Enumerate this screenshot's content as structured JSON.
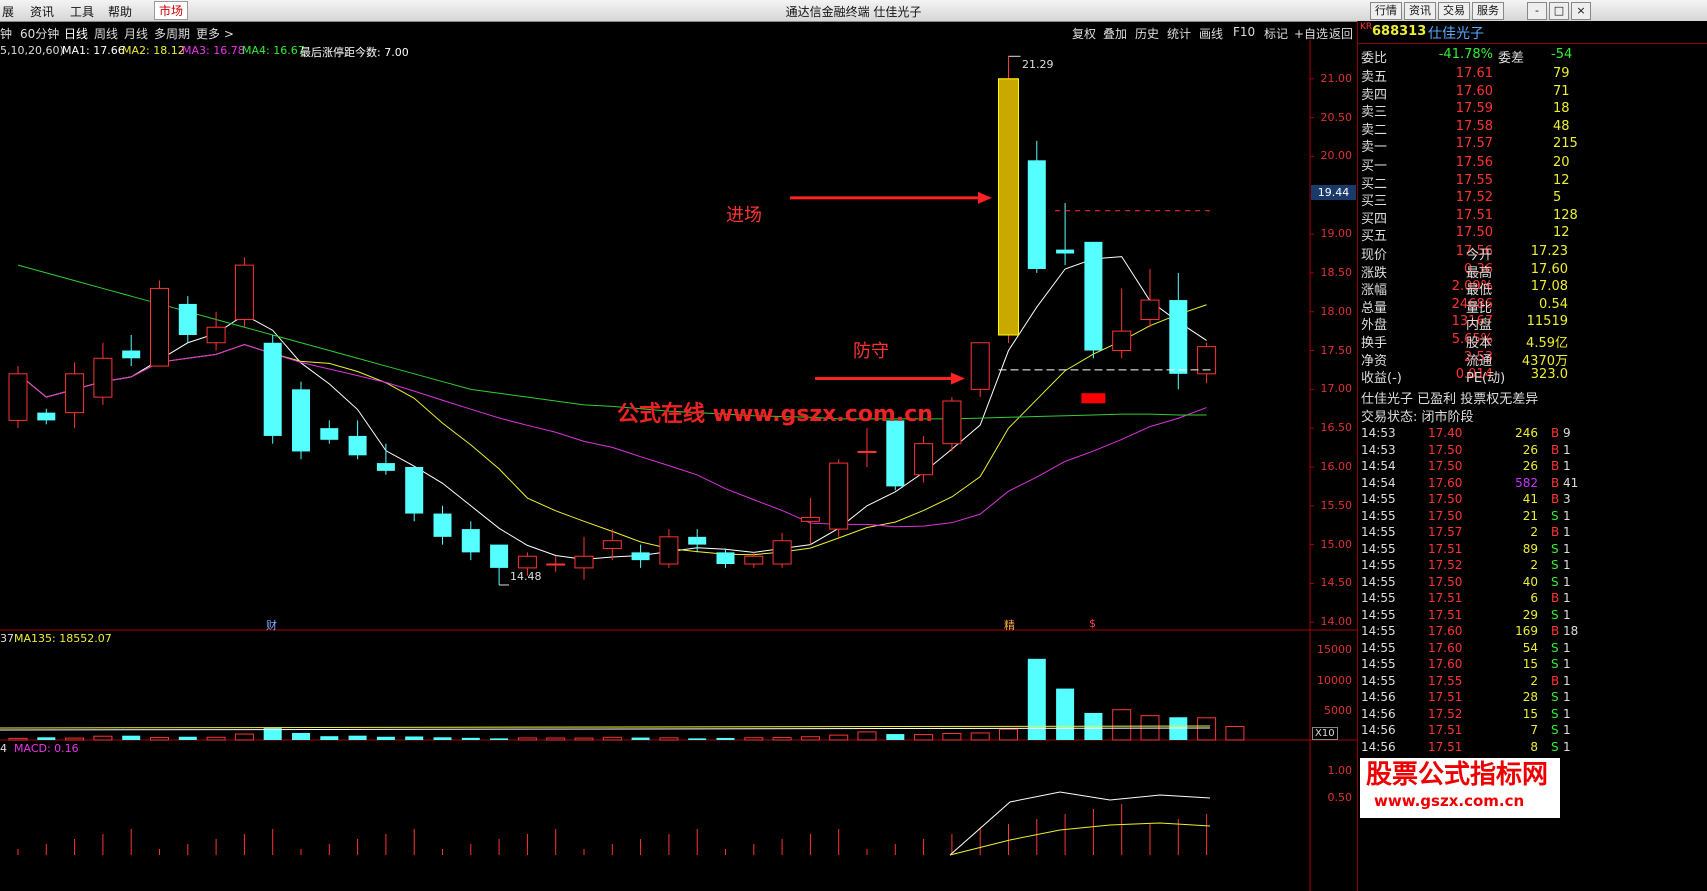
{
  "menubar": {
    "items": [
      "展",
      "资讯",
      "工具",
      "帮助",
      "市场"
    ],
    "title": "通达信金融终端  仕佳光子",
    "right_buttons": [
      "行情",
      "资讯",
      "交易",
      "服务"
    ],
    "window_buttons": [
      "-",
      "□",
      "×"
    ]
  },
  "periods": [
    "钟",
    "60分钟",
    "日线",
    "周线",
    "月线",
    "多周期",
    "更多 >"
  ],
  "tools": [
    "复权",
    "叠加",
    "历史",
    "统计",
    "画线",
    "F10",
    "标记",
    "+自选",
    "返回"
  ],
  "ma_legend": {
    "params": "5,10,20,60)",
    "ma1": "MA1: 17.66",
    "ma2": "MA2: 18.12",
    "ma3": "MA3: 16.78",
    "ma4": "MA4: 16.67",
    "extra": "最后涨停距今数: 7.00"
  },
  "price_axis": [
    "21.00",
    "20.50",
    "20.00",
    "19.50",
    "19.00",
    "18.50",
    "18.00",
    "17.50",
    "17.00",
    "16.50",
    "16.00",
    "15.50",
    "15.00",
    "14.50",
    "14.00"
  ],
  "current_price_tag": "19.44",
  "high_label": "21.29",
  "low_label": "14.48",
  "event_marks": [
    "财",
    "精",
    "$"
  ],
  "annotations": {
    "entry": "进场",
    "defend": "防守",
    "watermark": "公式在线  www.gszx.com.cn"
  },
  "volume_legend": {
    "left": "37",
    "ma135": "MA135: 18552.07"
  },
  "volume_axis": [
    "15000",
    "10000",
    "5000"
  ],
  "volume_unit": "X10",
  "macd_legend": {
    "left": "4",
    "macd": "MACD: 0.16"
  },
  "macd_axis": [
    "1.00",
    "0.50"
  ],
  "footer_logo": {
    "line1": "股票公式指标网",
    "line2": "www.gszx.com.cn"
  },
  "stock": {
    "tag": "KR",
    "code": "688313",
    "name": "仕佳光子"
  },
  "order_ratio": {
    "l1": "委比",
    "v1": "-41.78%",
    "l2": "委差",
    "v2": "-54"
  },
  "asks": [
    {
      "label": "卖五",
      "price": "17.61",
      "vol": "79"
    },
    {
      "label": "卖四",
      "price": "17.60",
      "vol": "71"
    },
    {
      "label": "卖三",
      "price": "17.59",
      "vol": "18"
    },
    {
      "label": "卖二",
      "price": "17.58",
      "vol": "48"
    },
    {
      "label": "卖一",
      "price": "17.57",
      "vol": "215"
    }
  ],
  "bids": [
    {
      "label": "买一",
      "price": "17.56",
      "vol": "20"
    },
    {
      "label": "买二",
      "price": "17.55",
      "vol": "12"
    },
    {
      "label": "买三",
      "price": "17.52",
      "vol": "5"
    },
    {
      "label": "买四",
      "price": "17.51",
      "vol": "128"
    },
    {
      "label": "买五",
      "price": "17.50",
      "vol": "12"
    }
  ],
  "quote": [
    {
      "l1": "现价",
      "v1": "17.56",
      "l2": "今开",
      "v2": "17.23"
    },
    {
      "l1": "涨跌",
      "v1": "0.36",
      "l2": "最高",
      "v2": "17.60"
    },
    {
      "l1": "涨幅",
      "v1": "2.09%",
      "l2": "最低",
      "v2": "17.08"
    },
    {
      "l1": "总量",
      "v1": "24686",
      "l2": "量比",
      "v2": "0.54"
    },
    {
      "l1": "外盘",
      "v1": "13167",
      "l2": "内盘",
      "v2": "11519"
    },
    {
      "l1": "换手",
      "v1": "5.65%",
      "l2": "股本",
      "v2": "4.59亿"
    },
    {
      "l1": "净资",
      "v1": "2.53",
      "l2": "流通",
      "v2": "4370万"
    },
    {
      "l1": "收益(-)",
      "v1": "0.014",
      "l2": "PE(动)",
      "v2": "323.0"
    }
  ],
  "status_line1": "仕佳光子 已盈利 投票权无差异",
  "status_line2": "交易状态: 闭市阶段",
  "ticks": [
    {
      "t": "14:53",
      "p": "17.40",
      "v": "246",
      "d": "B",
      "x": "9"
    },
    {
      "t": "14:53",
      "p": "17.50",
      "v": "26",
      "d": "B",
      "x": "1"
    },
    {
      "t": "14:54",
      "p": "17.50",
      "v": "26",
      "d": "B",
      "x": "1"
    },
    {
      "t": "14:54",
      "p": "17.60",
      "v": "582",
      "d": "B",
      "x": "41"
    },
    {
      "t": "14:55",
      "p": "17.50",
      "v": "41",
      "d": "B",
      "x": "3"
    },
    {
      "t": "14:55",
      "p": "17.50",
      "v": "21",
      "d": "S",
      "x": "1"
    },
    {
      "t": "14:55",
      "p": "17.57",
      "v": "2",
      "d": "B",
      "x": "1"
    },
    {
      "t": "14:55",
      "p": "17.51",
      "v": "89",
      "d": "S",
      "x": "1"
    },
    {
      "t": "14:55",
      "p": "17.52",
      "v": "2",
      "d": "S",
      "x": "1"
    },
    {
      "t": "14:55",
      "p": "17.50",
      "v": "40",
      "d": "S",
      "x": "1"
    },
    {
      "t": "14:55",
      "p": "17.51",
      "v": "6",
      "d": "B",
      "x": "1"
    },
    {
      "t": "14:55",
      "p": "17.51",
      "v": "29",
      "d": "S",
      "x": "1"
    },
    {
      "t": "14:55",
      "p": "17.60",
      "v": "169",
      "d": "B",
      "x": "18"
    },
    {
      "t": "14:55",
      "p": "17.60",
      "v": "54",
      "d": "S",
      "x": "1"
    },
    {
      "t": "14:55",
      "p": "17.60",
      "v": "15",
      "d": "S",
      "x": "1"
    },
    {
      "t": "14:55",
      "p": "17.55",
      "v": "2",
      "d": "B",
      "x": "1"
    },
    {
      "t": "14:56",
      "p": "17.51",
      "v": "28",
      "d": "S",
      "x": "1"
    },
    {
      "t": "14:56",
      "p": "17.52",
      "v": "15",
      "d": "S",
      "x": "1"
    },
    {
      "t": "14:56",
      "p": "17.51",
      "v": "7",
      "d": "S",
      "x": "1"
    },
    {
      "t": "14:56",
      "p": "17.51",
      "v": "8",
      "d": "S",
      "x": "1"
    }
  ],
  "chart_data": {
    "type": "candlestick",
    "ylim": [
      13.9,
      21.5
    ],
    "candles": [
      {
        "o": 16.6,
        "c": 17.2,
        "h": 17.3,
        "l": 16.5
      },
      {
        "o": 16.7,
        "c": 16.6,
        "h": 16.75,
        "l": 16.55
      },
      {
        "o": 16.7,
        "c": 17.2,
        "h": 17.35,
        "l": 16.5
      },
      {
        "o": 16.9,
        "c": 17.4,
        "h": 17.6,
        "l": 16.8
      },
      {
        "o": 17.5,
        "c": 17.4,
        "h": 17.7,
        "l": 17.3
      },
      {
        "o": 17.3,
        "c": 18.3,
        "h": 18.4,
        "l": 17.3
      },
      {
        "o": 18.1,
        "c": 17.7,
        "h": 18.2,
        "l": 17.6
      },
      {
        "o": 17.6,
        "c": 17.8,
        "h": 18.0,
        "l": 17.5
      },
      {
        "o": 17.9,
        "c": 18.6,
        "h": 18.7,
        "l": 17.8
      },
      {
        "o": 17.6,
        "c": 16.4,
        "h": 17.7,
        "l": 16.3
      },
      {
        "o": 17.0,
        "c": 16.2,
        "h": 17.1,
        "l": 16.1
      },
      {
        "o": 16.5,
        "c": 16.35,
        "h": 16.6,
        "l": 16.3
      },
      {
        "o": 16.4,
        "c": 16.15,
        "h": 16.6,
        "l": 16.1
      },
      {
        "o": 16.05,
        "c": 15.95,
        "h": 16.3,
        "l": 15.9
      },
      {
        "o": 16.0,
        "c": 15.4,
        "h": 16.0,
        "l": 15.3
      },
      {
        "o": 15.4,
        "c": 15.1,
        "h": 15.5,
        "l": 15.0
      },
      {
        "o": 15.2,
        "c": 14.9,
        "h": 15.3,
        "l": 14.8
      },
      {
        "o": 15.0,
        "c": 14.7,
        "h": 15.0,
        "l": 14.48
      },
      {
        "o": 14.7,
        "c": 14.85,
        "h": 14.9,
        "l": 14.6
      },
      {
        "o": 14.75,
        "c": 14.75,
        "h": 14.85,
        "l": 14.65
      },
      {
        "o": 14.7,
        "c": 14.85,
        "h": 15.1,
        "l": 14.55
      },
      {
        "o": 14.95,
        "c": 15.05,
        "h": 15.2,
        "l": 14.8
      },
      {
        "o": 14.9,
        "c": 14.8,
        "h": 15.0,
        "l": 14.7
      },
      {
        "o": 14.75,
        "c": 15.1,
        "h": 15.2,
        "l": 14.7
      },
      {
        "o": 15.1,
        "c": 15.0,
        "h": 15.2,
        "l": 14.9
      },
      {
        "o": 14.9,
        "c": 14.75,
        "h": 14.95,
        "l": 14.7
      },
      {
        "o": 14.75,
        "c": 14.85,
        "h": 14.9,
        "l": 14.7
      },
      {
        "o": 14.75,
        "c": 15.05,
        "h": 15.15,
        "l": 14.7
      },
      {
        "o": 15.3,
        "c": 15.35,
        "h": 15.6,
        "l": 15.0
      },
      {
        "o": 15.2,
        "c": 16.05,
        "h": 16.1,
        "l": 15.1
      },
      {
        "o": 16.2,
        "c": 16.2,
        "h": 16.5,
        "l": 16.0
      },
      {
        "o": 16.6,
        "c": 15.75,
        "h": 16.6,
        "l": 15.7
      },
      {
        "o": 15.9,
        "c": 16.3,
        "h": 16.4,
        "l": 15.8
      },
      {
        "o": 16.3,
        "c": 16.85,
        "h": 16.9,
        "l": 16.2
      },
      {
        "o": 17.0,
        "c": 17.6,
        "h": 17.6,
        "l": 16.9
      },
      {
        "o": 17.7,
        "c": 21.0,
        "h": 21.29,
        "l": 17.6
      },
      {
        "o": 19.95,
        "c": 18.55,
        "h": 20.2,
        "l": 18.5
      },
      {
        "o": 18.8,
        "c": 18.75,
        "h": 19.4,
        "l": 18.6
      },
      {
        "o": 18.9,
        "c": 17.5,
        "h": 18.9,
        "l": 17.4
      },
      {
        "o": 17.5,
        "c": 17.75,
        "h": 18.3,
        "l": 17.4
      },
      {
        "o": 17.9,
        "c": 18.15,
        "h": 18.55,
        "l": 17.8
      },
      {
        "o": 18.15,
        "c": 17.2,
        "h": 18.5,
        "l": 17.0
      },
      {
        "o": 17.2,
        "c": 17.55,
        "h": 17.6,
        "l": 17.08
      }
    ],
    "volume": [
      300,
      500,
      350,
      700,
      800,
      450,
      600,
      500,
      1100,
      2200,
      1300,
      700,
      800,
      600,
      650,
      500,
      400,
      300,
      380,
      360,
      350,
      500,
      450,
      400,
      300,
      380,
      420,
      450,
      600,
      900,
      1500,
      1100,
      1000,
      1200,
      1300,
      2000,
      15000,
      9500,
      5000,
      5600,
      4500,
      4200,
      4100,
      2500
    ],
    "levels": {
      "entry": 19.3,
      "defend": 17.25
    }
  }
}
